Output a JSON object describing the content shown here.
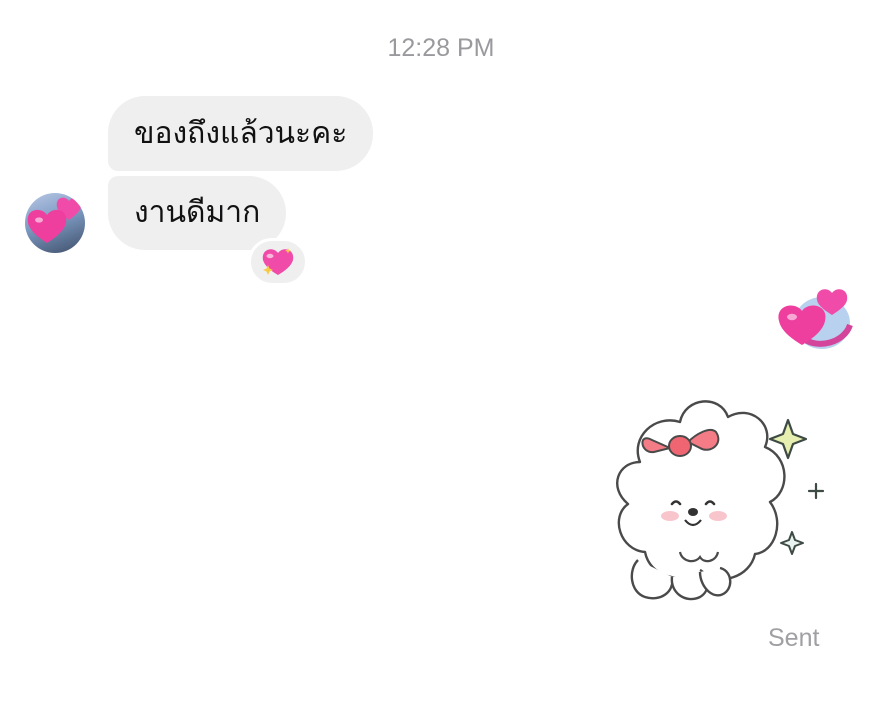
{
  "conversation": {
    "timestamp": "12:28 PM",
    "messages": [
      {
        "sender": "other",
        "text": "ของถึงแล้วนะคะ"
      },
      {
        "sender": "other",
        "text": "งานดีมาก"
      }
    ],
    "reaction": {
      "icon": "sparkling-heart-icon",
      "emoji": "💖"
    },
    "seen_indicator": {
      "icon": "two-hearts-icon"
    },
    "sticker": {
      "icon": "fluffy-puppy-sticker"
    },
    "status": "Sent"
  },
  "colors": {
    "bubble_incoming": "#efeff0",
    "timestamp_text": "#9a9a9e",
    "status_text": "#a0a0a4",
    "heart_pink": "#f04ba8"
  }
}
